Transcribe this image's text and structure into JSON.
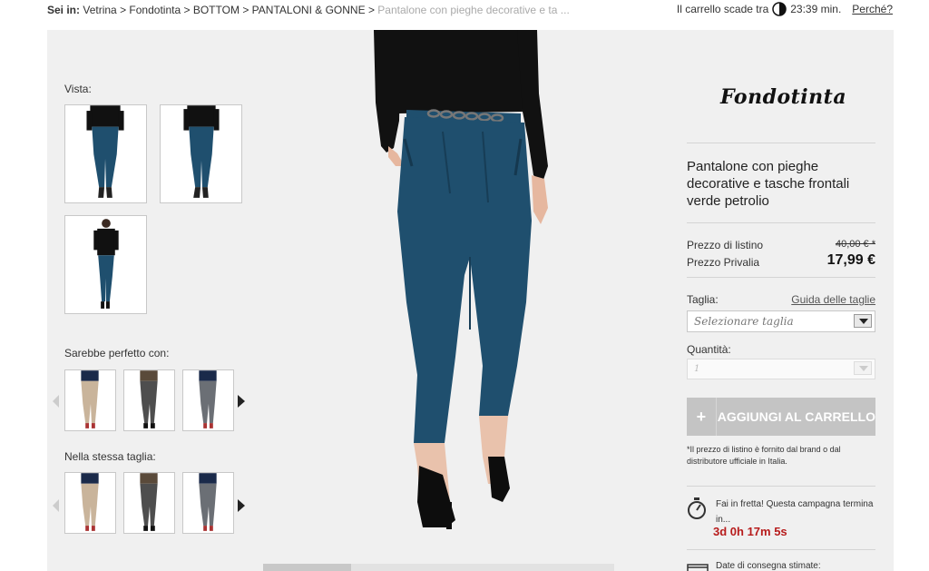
{
  "breadcrumb": {
    "lead": "Sei in:",
    "items": [
      "Vetrina",
      "Fondotinta",
      "BOTTOM",
      "PANTALONI & GONNE"
    ],
    "current": "Pantalone con pieghe decorative e ta ...",
    "separator": ">"
  },
  "cart_timer": {
    "prefix": "Il carrello scade tra",
    "time": "23:39 min.",
    "why_link": "Perché?"
  },
  "gallery": {
    "views_label": "Vista:",
    "perfect_with_label": "Sarebbe perfetto con:",
    "same_size_label": "Nella stessa taglia:"
  },
  "product": {
    "brand": "Fondotinta",
    "title": "Pantalone con pieghe decorative e tasche frontali verde petrolio",
    "list_price_label": "Prezzo di listino",
    "list_price": "40,00 € *",
    "sale_price_label": "Prezzo Privalia",
    "sale_price": "17,99 €",
    "size_label": "Taglia:",
    "size_guide": "Guida delle taglie",
    "size_placeholder": "Selezionare taglia",
    "quantity_label": "Quantità:",
    "quantity_value": "1",
    "add_to_cart_icon": "+",
    "add_to_cart": "AGGIUNGI AL CARRELLO",
    "note": "*Il prezzo di listino è fornito dal brand o dal distributore ufficiale in Italia.",
    "hurry_text": "Fai in fretta! Questa campagna termina in...",
    "countdown": "3d 0h 17m 5s",
    "delivery_label": "Date di consegna stimate:"
  },
  "colors": {
    "pants": "#1f4f6e",
    "top": "#111111",
    "panel_bg": "#f0f0f0",
    "countdown": "#b71c1c",
    "button_disabled": "#c4c4c4"
  },
  "icons": {
    "clock": "clock-icon",
    "timer": "stopwatch-icon",
    "delivery": "delivery-icon",
    "scroll_left": "chevron-left-icon",
    "scroll_right": "chevron-right-icon",
    "dropdown": "chevron-down-icon"
  }
}
